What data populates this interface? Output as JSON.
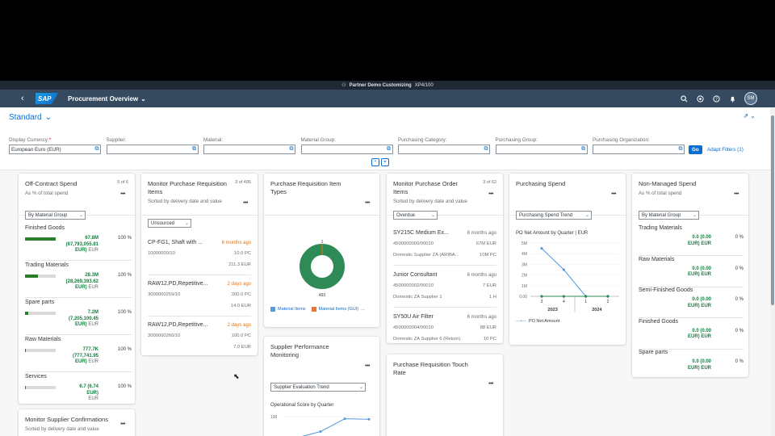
{
  "window": {
    "title": "Partner Demo Customizing",
    "system": "XP4/100"
  },
  "shell": {
    "logo": "SAP",
    "back": "‹",
    "app_title": "Procurement Overview",
    "title_chevron": "⌄",
    "avatar": "SM"
  },
  "header": {
    "variant": "Standard",
    "variant_chevron": "⌄",
    "go": "Go",
    "adapt": "Adapt Filters (1)",
    "filters": [
      {
        "label": "Display Currency:",
        "required": "*",
        "value": "European Euro (EUR)"
      },
      {
        "label": "Supplier:",
        "value": ""
      },
      {
        "label": "Material:",
        "value": ""
      },
      {
        "label": "Material Group:",
        "value": ""
      },
      {
        "label": "Purchasing Category:",
        "value": ""
      },
      {
        "label": "Purchasing Group:",
        "value": ""
      },
      {
        "label": "Purchasing Organization:",
        "value": ""
      }
    ]
  },
  "cards": {
    "offcontract": {
      "title": "Off-Contract Spend",
      "count": "5 of 6",
      "sub": "As % of total spend",
      "select": "By Material Group",
      "items": [
        {
          "name": "Finished Goods",
          "fill": 1.0,
          "v1": "67.8M",
          "v2": "(67,793,055.81",
          "v3": "EUR)",
          "unit": "EUR",
          "pct": "100 %"
        },
        {
          "name": "Trading Materials",
          "fill": 0.42,
          "v1": "28.3M",
          "v2": "(28,269,393.62",
          "v3": "EUR)",
          "unit": "EUR",
          "pct": "100 %"
        },
        {
          "name": "Spare parts",
          "fill": 0.11,
          "v1": "7.2M",
          "v2": "(7,205,100.45",
          "v3": "EUR)",
          "unit": "EUR",
          "pct": "100 %"
        },
        {
          "name": "Raw Materials",
          "fill": 0.02,
          "v1": "777.7K",
          "v2": "(777,741.95",
          "v3": "EUR)",
          "unit": "EUR",
          "pct": "100 %"
        },
        {
          "name": "Services",
          "fill": 0.01,
          "v1": "6.7 (6.74",
          "v2": "EUR)",
          "v3": "",
          "unit": "EUR",
          "pct": "100 %"
        }
      ]
    },
    "supplier_conf": {
      "title": "Monitor Supplier Confirmations",
      "sub": "Sorted by delivery date and value"
    },
    "pr_items": {
      "title": "Monitor Purchase Requisition Items",
      "count": "3 of 495",
      "sub": "Sorted by delivery date and value",
      "select": "Unsourced",
      "items": [
        {
          "t": "CP-FG1, Shaft with ...",
          "tr": "6 months ago",
          "s1": "10000000/10",
          "r1": "10.0 PC",
          "r2": "211.3 EUR"
        },
        {
          "t": "RAW12,PD,Repetitive...",
          "tr": "2 days ago",
          "s1": "3000000259/10",
          "r1": "200.0 PC",
          "r2": "14.0 EUR"
        },
        {
          "t": "RAW12,PD,Repetitive...",
          "tr": "2 days ago",
          "s1": "3000000260/10",
          "r1": "100.0 PC",
          "r2": "7.0 EUR"
        }
      ]
    },
    "pr_types": {
      "title": "Purchase Requisition Item Types",
      "donut": {
        "top": "1",
        "bottom": "493",
        "values": [
          493,
          1
        ],
        "colors": [
          "#2e8b57",
          "#e9730c"
        ]
      },
      "legend": [
        "Material Items",
        "Material Items (GUI)",
        "..."
      ]
    },
    "supplier_perf": {
      "title": "Supplier Performance Monitoring",
      "select": "Supplier Evaluation Trend",
      "chart_title": "Operational Score by Quarter",
      "ytick": "100"
    },
    "po_items": {
      "title": "Monitor Purchase Order Items",
      "count": "3 of 62",
      "sub": "Sorted by delivery date and value",
      "select": "Overdue",
      "items": [
        {
          "t": "SY215C Medium Ex...",
          "tr": "8 months ago",
          "s1": "4500000000/00010",
          "r1": "67M EUR",
          "s2": "Domestic Supplier ZA (ARIBA...",
          "r2": "10M PC"
        },
        {
          "t": "Junior Consultant",
          "tr": "6 months ago",
          "s1": "4500000002/00010",
          "r1": "7 EUR",
          "s2": "Domestic ZA Supplier 1",
          "r2": "1 H"
        },
        {
          "t": "SY50U Air Filter",
          "tr": "6 months ago",
          "s1": "4500000004/00010",
          "r1": "88 EUR",
          "s2": "Domestic ZA Supplier 6 (Return)",
          "r2": "10 PC"
        }
      ]
    },
    "pr_touch": {
      "title": "Purchase Requisition Touch Rate"
    },
    "purch_spend": {
      "title": "Purchasing Spend",
      "select": "Purchasing Spend Trend",
      "chart_title": "PO Net Amount by Quarter | EUR",
      "legend": "PO Net Amount"
    },
    "nonmanaged": {
      "title": "Non-Managed Spend",
      "sub": "As % of total spend",
      "select": "By Material Group",
      "items": [
        {
          "name": "Trading Materials",
          "v1": "0.0 (0.00",
          "v2": "EUR) EUR",
          "pct": "0 %"
        },
        {
          "name": "Raw Materials",
          "v1": "0.0 (0.00",
          "v2": "EUR) EUR",
          "pct": "0 %"
        },
        {
          "name": "Semi-Finished Goods",
          "v1": "0.0 (0.00",
          "v2": "EUR) EUR",
          "pct": "0 %"
        },
        {
          "name": "Finished Goods",
          "v1": "0.0 (0.00",
          "v2": "EUR) EUR",
          "pct": "0 %"
        },
        {
          "name": "Spare parts",
          "v1": "0.0 (0.00",
          "v2": "EUR) EUR",
          "pct": "0 %"
        }
      ]
    }
  },
  "chart_data": [
    {
      "type": "line",
      "title": "PO Net Amount by Quarter | EUR",
      "x": [
        "3",
        "4",
        "1",
        "2"
      ],
      "groups": [
        "2023",
        "2024"
      ],
      "y_ticks": [
        "5M",
        "4M",
        "3M",
        "2M",
        "1M",
        "0.00"
      ],
      "ylim": [
        0,
        5000000
      ],
      "series": [
        {
          "name": "PO Net Amount",
          "values": [
            4500000,
            2500000,
            0,
            0
          ]
        },
        {
          "values": [
            0,
            0,
            0,
            0
          ]
        }
      ]
    },
    {
      "type": "line",
      "title": "Operational Score by Quarter",
      "y_ticks": [
        "100"
      ],
      "series": [
        {
          "values": [
            60,
            72,
            96,
            95
          ]
        }
      ]
    },
    {
      "type": "pie",
      "categories": [
        "Material Items",
        "Material Items (GUI)"
      ],
      "values": [
        493,
        1
      ]
    }
  ]
}
